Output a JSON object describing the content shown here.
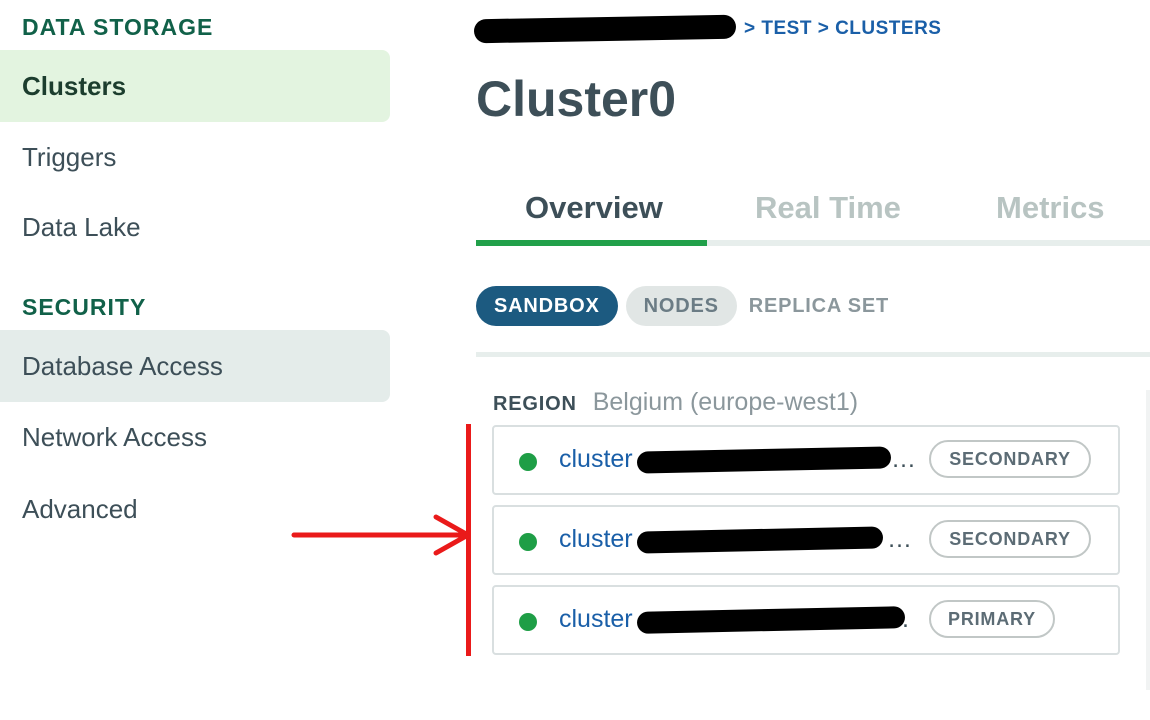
{
  "sidebar": {
    "data_storage_title": "DATA STORAGE",
    "data_storage_items": [
      "Clusters",
      "Triggers",
      "Data Lake"
    ],
    "security_title": "SECURITY",
    "security_items": [
      "Database Access",
      "Network Access",
      "Advanced"
    ]
  },
  "breadcrumb": {
    "trail": "> TEST > CLUSTERS"
  },
  "page": {
    "title": "Cluster0"
  },
  "tabs": [
    "Overview",
    "Real Time",
    "Metrics"
  ],
  "filters": {
    "sandbox": "SANDBOX",
    "nodes": "NODES",
    "replica_set": "REPLICA SET"
  },
  "region": {
    "label": "REGION",
    "value": "Belgium (europe-west1)"
  },
  "nodes": [
    {
      "name_prefix": "cluster",
      "ellipsis": "…",
      "role": "SECONDARY",
      "status_color": "#1e9e46"
    },
    {
      "name_prefix": "cluster",
      "ellipsis": "…",
      "role": "SECONDARY",
      "status_color": "#1e9e46"
    },
    {
      "name_prefix": "cluster",
      "ellipsis": ".",
      "role": "PRIMARY",
      "status_color": "#1e9e46"
    }
  ],
  "colors": {
    "accent_green": "#21a04a",
    "link_blue": "#1a5fa8",
    "annotation_red": "#ea1a1a"
  }
}
